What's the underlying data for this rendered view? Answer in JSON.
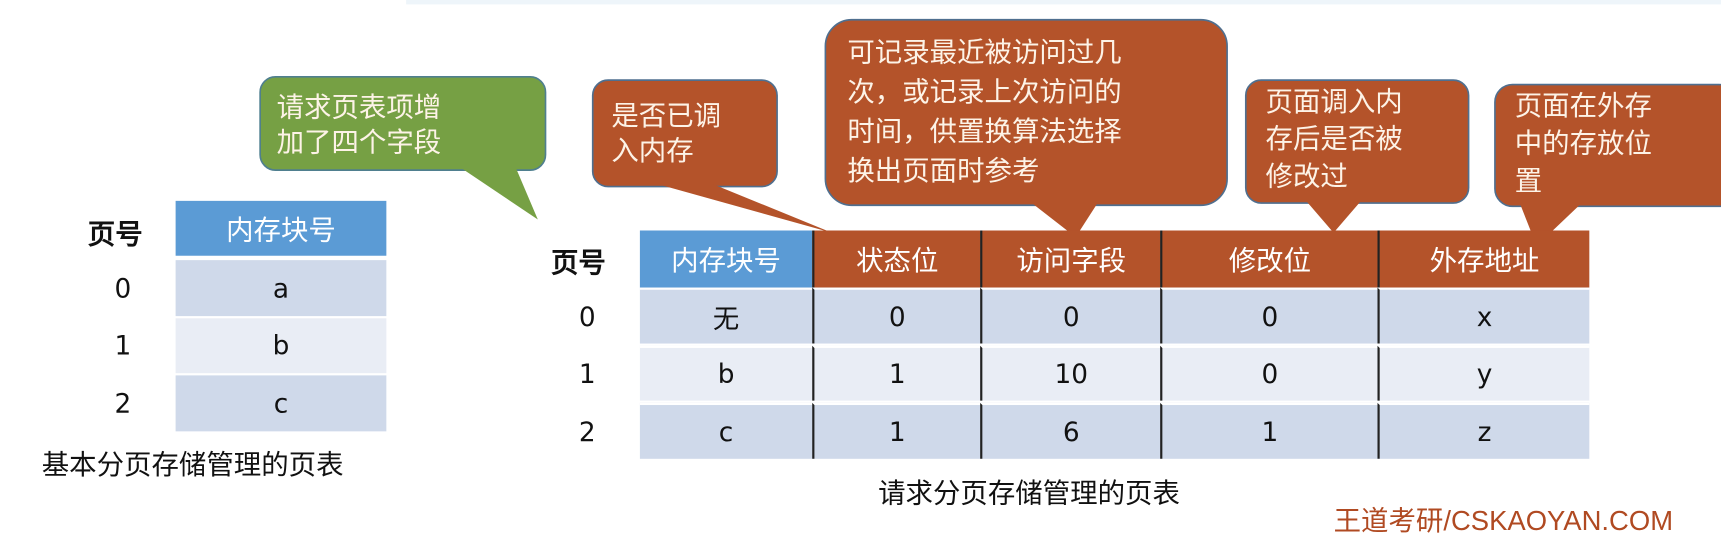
{
  "colors": {
    "green_callout": "#76a044",
    "orange_callout": "#b4532a",
    "blue_header": "#5b9bd5",
    "orange_header": "#b4532a",
    "row_dark": "#cfd9ea",
    "row_light": "#e9edf5",
    "watermark": "#b04a22"
  },
  "callouts": {
    "green": "请求页表项增\n加了四个字段",
    "status": "是否已调\n入内存",
    "access": "可记录最近被访问过几\n次，或记录上次访问的\n时间，供置换算法选择\n换出页面时参考",
    "modified": "页面调入内\n存后是否被\n修改过",
    "external": "页面在外存\n中的存放位\n置"
  },
  "basic_table": {
    "page_label": "页号",
    "header": "内存块号",
    "rows": [
      {
        "page": "0",
        "block": "a"
      },
      {
        "page": "1",
        "block": "b"
      },
      {
        "page": "2",
        "block": "c"
      }
    ],
    "caption": "基本分页存储管理的页表"
  },
  "demand_table": {
    "page_label": "页号",
    "headers": [
      "内存块号",
      "状态位",
      "访问字段",
      "修改位",
      "外存地址"
    ],
    "rows": [
      {
        "page": "0",
        "cells": [
          "无",
          "0",
          "0",
          "0",
          "x"
        ]
      },
      {
        "page": "1",
        "cells": [
          "b",
          "1",
          "10",
          "0",
          "y"
        ]
      },
      {
        "page": "2",
        "cells": [
          "c",
          "1",
          "6",
          "1",
          "z"
        ]
      }
    ],
    "caption": "请求分页存储管理的页表"
  },
  "watermark": "王道考研/CSKAOYAN.COM"
}
